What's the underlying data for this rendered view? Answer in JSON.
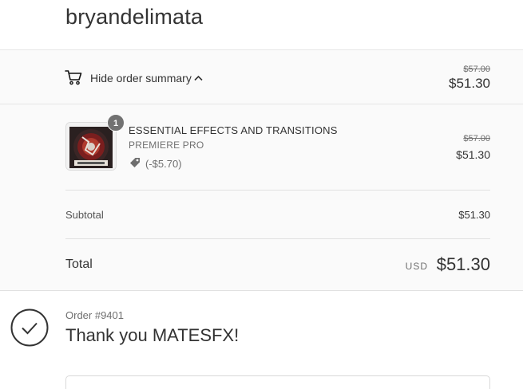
{
  "header": {
    "store_name": "bryandelimata"
  },
  "summary_toggle": {
    "label": "Hide order summary",
    "original_total": "$57.00",
    "total": "$51.30",
    "cart_icon": "cart-icon",
    "chevron_icon": "chevron-up-icon"
  },
  "line_items": [
    {
      "quantity": "1",
      "name": "ESSENTIAL EFFECTS AND TRANSITIONS",
      "variant": "PREMIERE PRO",
      "discount": "(-$5.70)",
      "discount_icon": "tag-icon",
      "original_price": "$57.00",
      "price": "$51.30"
    }
  ],
  "totals": {
    "subtotal_label": "Subtotal",
    "subtotal_value": "$51.30",
    "total_label": "Total",
    "currency": "USD",
    "total_value": "$51.30"
  },
  "confirmation": {
    "order_number": "Order #9401",
    "thank_you": "Thank you MATESFX!",
    "icon": "checkmark-circle-icon"
  },
  "colors": {
    "text": "#333333",
    "muted": "#707070",
    "summary_bg": "#fafafa",
    "badge": "#727272"
  }
}
